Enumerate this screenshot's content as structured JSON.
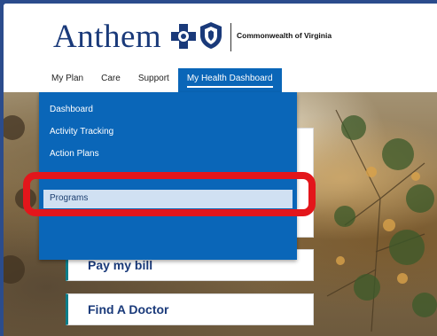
{
  "header": {
    "brand": "Anthem",
    "subtitle": "Commonwealth of Virginia"
  },
  "nav": {
    "items": [
      {
        "label": "My Plan"
      },
      {
        "label": "Care"
      },
      {
        "label": "Support"
      },
      {
        "label": "My Health Dashboard"
      }
    ],
    "active_index": 3
  },
  "dropdown": {
    "items": [
      {
        "label": "Dashboard"
      },
      {
        "label": "Activity Tracking"
      },
      {
        "label": "Action Plans"
      }
    ],
    "selected_label": "Programs"
  },
  "cards": {
    "pay_bill": "Pay my bill",
    "find_doctor": "Find A Doctor"
  },
  "colors": {
    "brand_blue": "#1a3a7a",
    "menu_blue": "#0a66b8",
    "selected_bg": "#d0e0f2",
    "highlight_red": "#e3161b",
    "card_accent": "#0b7d8a"
  }
}
